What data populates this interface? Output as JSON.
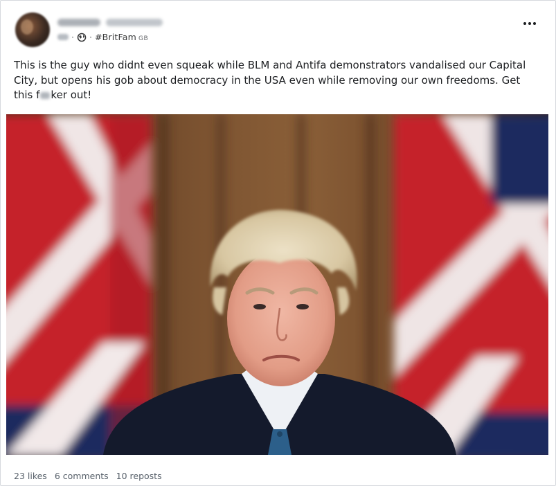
{
  "post": {
    "author_name": "",
    "author_handle": "",
    "time": "",
    "group_tag": "#BritFam",
    "group_suffix": "GB",
    "text_part1": "This is the guy who didnt even squeak while BLM and Antifa demonstrators vandalised our Capital City, but opens his gob about democracy in the USA even while removing our own freedoms. Get this f",
    "text_part2": "ker out!",
    "image_icon": "photo-of-man-with-union-flags"
  },
  "stats": {
    "likes": "23 likes",
    "comments": "6 comments",
    "reposts": "10 reposts"
  },
  "colors": {
    "flag_red": "#c8202a",
    "flag_blue": "#1d2e6b",
    "backdrop": "#6b4526"
  }
}
